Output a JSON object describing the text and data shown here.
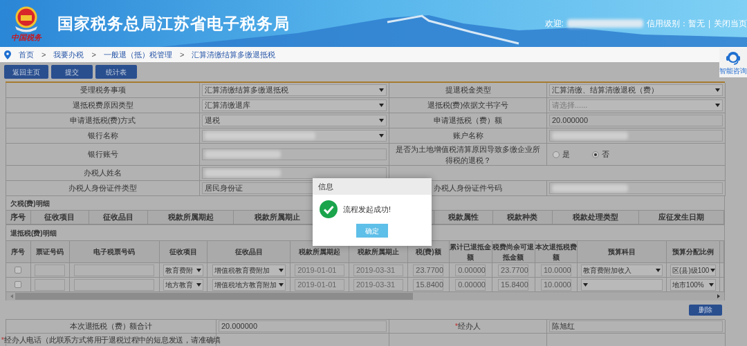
{
  "header": {
    "logo_text": "中国税务",
    "title": "国家税务总局江苏省电子税务局",
    "welcome": "欢迎:",
    "welcome_redacted": true,
    "credit": "信用级别：暂无",
    "separator": "|",
    "close": "关闭当页"
  },
  "breadcrumb": {
    "separator": ">",
    "items": [
      "首页",
      "我要办税",
      "一般退（抵）税管理",
      "汇算清缴结算多缴退抵税"
    ]
  },
  "help_widget": {
    "label": "智能咨询"
  },
  "toolbar": {
    "buttons": [
      "返回主页",
      "提交",
      "统计表"
    ]
  },
  "form": [
    {
      "label": "受理税务事项",
      "field": {
        "kind": "select",
        "value": "汇算清缴结算多缴退抵税"
      },
      "label2": "提退税金类型",
      "field2": {
        "kind": "select",
        "value": "汇算清缴、结算清缴退税（费）"
      }
    },
    {
      "label": "退抵税费原因类型",
      "field": {
        "kind": "select",
        "value": "汇算清缴退库"
      },
      "label2": "退抵税(费)依据文书字号",
      "field2": {
        "kind": "select",
        "placeholder": "请选择......"
      }
    },
    {
      "label": "申请退抵税(费)方式",
      "field": {
        "kind": "select",
        "value": "退税"
      },
      "label2": "申请退抵税（费）额",
      "field2": {
        "kind": "input",
        "value": "20.000000"
      }
    },
    {
      "label": "银行名称",
      "field": {
        "kind": "select",
        "redacted": true
      },
      "label2": "账户名称",
      "field2": {
        "kind": "input",
        "redacted": true
      }
    },
    {
      "label": "银行账号",
      "field": {
        "kind": "input",
        "redacted": true
      },
      "label2": "是否为土地增值税清算原因导致多缴企业所得税的退税？",
      "field2": {
        "kind": "radio",
        "options": [
          {
            "label": "是",
            "selected": false
          },
          {
            "label": "否",
            "selected": true
          }
        ]
      }
    },
    {
      "label": "办税人姓名",
      "field": {
        "kind": "input",
        "redacted": true
      }
    },
    {
      "label": "办税人身份证件类型",
      "field": {
        "kind": "input",
        "value": "居民身份证"
      },
      "label2": "办税人身份证件号码",
      "field2": {
        "kind": "input",
        "redacted": true
      }
    }
  ],
  "arrears": {
    "title": "欠税(费)明细",
    "columns": [
      "序号",
      "征收项目",
      "征收品目",
      "税款所属期起",
      "税款所属期止",
      "",
      "税款属性",
      "税款种类",
      "税款处理类型",
      "应征发生日期"
    ]
  },
  "refunds": {
    "title": "退抵税(费)明细",
    "columns": [
      "序号",
      "票证号码",
      "电子税票号码",
      "征收项目",
      "征收品目",
      "税款所属期起",
      "税款所属期止",
      "税(费)额",
      "累计已退抵金额",
      "税费尚余可退抵金额",
      "本次退抵税费额",
      "预算科目",
      "预算分配比例",
      ""
    ],
    "rows": [
      {
        "checked": false,
        "item": "教育费附",
        "subitem": "增值税教育费附加",
        "start": "2019-01-01",
        "end": "2019-03-31",
        "amount": "23.7700",
        "refunded": "0.00000",
        "remaining": "23.7700",
        "current": "10.0000",
        "budget_subject": "教育费附加收入",
        "ratio": "区(县)级100"
      },
      {
        "checked": false,
        "item": "地方教育",
        "subitem": "增值税地方教育附加",
        "start": "2019-01-01",
        "end": "2019-03-31",
        "amount": "15.8400",
        "refunded": "0.00000",
        "remaining": "15.8400",
        "current": "10.0000",
        "ratio": "地市100%"
      }
    ],
    "delete_button": "删除"
  },
  "required_mark": "*",
  "summary": [
    {
      "label": "本次退抵税（费）额合计",
      "value": "20.000000",
      "label2": "经办人",
      "required2": true,
      "value2": "陈旭红"
    },
    {
      "label": "经办人电话（此联系方式将用于退税过程中的短息发送，请准确填",
      "required": true
    }
  ],
  "dialog": {
    "title": "信息",
    "message": "流程发起成功!",
    "button": "确定"
  }
}
